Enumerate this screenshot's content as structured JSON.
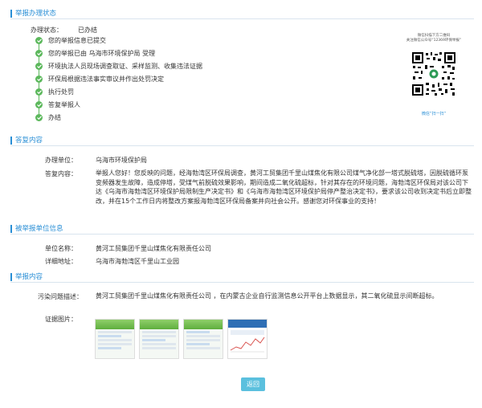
{
  "sections": {
    "status_title": "举报办理状态",
    "reply_title": "答复内容",
    "target_title": "被举报单位信息",
    "report_title": "举报内容"
  },
  "status": {
    "label": "办理状态：",
    "value": "已办结",
    "steps": [
      "您的举报信息已提交",
      "您的举报已由 乌海市环境保护局 受理",
      "环境执法人员现场调查取证、采样监测、收集违法证据",
      "环保局根据违法事实审议并作出处罚决定",
      "执行处罚",
      "答复举报人",
      "办结"
    ]
  },
  "qr": {
    "caption_top": "微信扫描下方二维码",
    "caption_top2": "关注微信公众号“12369环保举报”",
    "caption_bottom": "微信“扫一扫”"
  },
  "reply": {
    "unit_label": "办理单位：",
    "unit_value": "乌海市环境保护局",
    "content_label": "答复内容：",
    "content_value": "举报人您好！您反映的问题，经海勃湾区环保局调查，黄河工贸集团千里山煤焦化有限公司煤气净化部一塔式脱硫塔，因脱硫循环泵变频器发生故障，造成停塔，受煤气前脱硫效果影响，期间造成二氧化硫超标，针对其存在的环境问题，海勃湾区环保局对该公司下达《乌海市海勃湾区环境保护局限制生产决定书》和《乌海市海勃湾区环境保护局停产整治决定书》，要求该公司收到决定书后立即整改，并在15个工作日内将整改方案报海勃湾区环保局备案并向社会公开。感谢您对环保事业的支持！"
  },
  "target": {
    "name_label": "单位名称：",
    "name_value": "黄河工贸集团千里山煤焦化有限责任公司",
    "address_label": "详细地址：",
    "address_value": "乌海市海勃湾区千里山工业园"
  },
  "report": {
    "problem_label": "污染问题描述：",
    "problem_value": "黄河工贸集团千里山煤焦化有限责任公司 ，在内蒙古企业自行监测信息公开平台上数据显示，其二氧化硫显示间断超标。",
    "images_label": "证据图片："
  },
  "buttons": {
    "back": "返回"
  },
  "colors": {
    "accent": "#2a8fd6",
    "success": "#5cb85c",
    "button": "#5bc0de"
  }
}
